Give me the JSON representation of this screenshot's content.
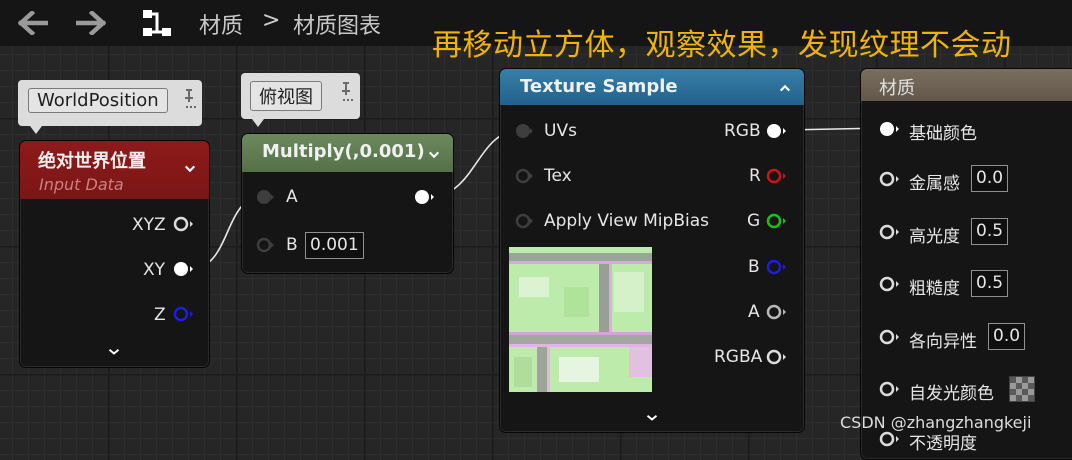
{
  "toolbar": {
    "back_icon": "arrow-left-icon",
    "forward_icon": "arrow-right-icon",
    "graph_icon": "graph-nodes-icon",
    "breadcrumb_1": "材质",
    "separator": ">",
    "breadcrumb_2": "材质图表"
  },
  "overlay_text": "再移动立方体，观察效果，发现纹理不会动",
  "world_position": {
    "comment": "WorldPosition",
    "title": "绝对世界位置",
    "subtitle": "Input Data",
    "pins": [
      "XYZ",
      "XY",
      "Z"
    ]
  },
  "multiply": {
    "comment": "俯视图",
    "title": "Multiply(,0.001)",
    "pin_a": "A",
    "pin_b": "B",
    "b_value": "0.001"
  },
  "texture_sample": {
    "title": "Texture Sample",
    "inputs": [
      "UVs",
      "Tex",
      "Apply View MipBias"
    ],
    "outputs": [
      "RGB",
      "R",
      "G",
      "B",
      "A",
      "RGBA"
    ]
  },
  "material": {
    "title": "材质",
    "base_color": "基础颜色",
    "metallic": "金属感",
    "metallic_value": "0.0",
    "specular": "高光度",
    "specular_value": "0.5",
    "roughness": "粗糙度",
    "roughness_value": "0.5",
    "anisotropy": "各向异性",
    "anisotropy_value": "0.0",
    "emissive": "自发光颜色",
    "opacity_partial": "不透明度"
  },
  "colors": {
    "world_position_header": "#8c1c1c",
    "multiply_header": "#5e7a52",
    "texture_header": "#2e6f96",
    "material_header": "#6e6252",
    "overlay_text": "#f0b400",
    "pin_red": "#d0121b",
    "pin_green": "#19c21b",
    "pin_blue": "#1d1ddc"
  },
  "watermark": "CSDN @zhangzhangkeji"
}
